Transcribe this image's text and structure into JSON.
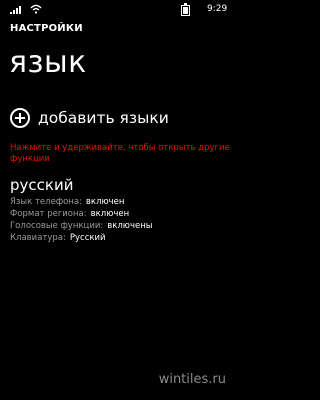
{
  "status": {
    "time": "9:29",
    "icons": [
      "signal-icon",
      "wifi-icon",
      "battery-icon"
    ]
  },
  "header": {
    "app_title": "НАСТРОЙКИ",
    "page_title": "язык"
  },
  "add_languages": {
    "icon": "add-circle-icon",
    "label": "добавить языки"
  },
  "hint": "Нажмите и удерживайте, чтобы открыть другие функции",
  "language": {
    "name": "русский",
    "details": [
      {
        "label": "Язык телефона:",
        "value": "включен"
      },
      {
        "label": "Формат региона:",
        "value": "включен"
      },
      {
        "label": "Голосовые функции:",
        "value": "включены"
      },
      {
        "label": "Клавиатура:",
        "value": "Русский"
      }
    ]
  },
  "watermark": "wintiles.ru",
  "colors": {
    "background": "#000000",
    "text": "#ffffff",
    "accent_hint": "#e51400",
    "label_gray": "#9a9a9a"
  }
}
